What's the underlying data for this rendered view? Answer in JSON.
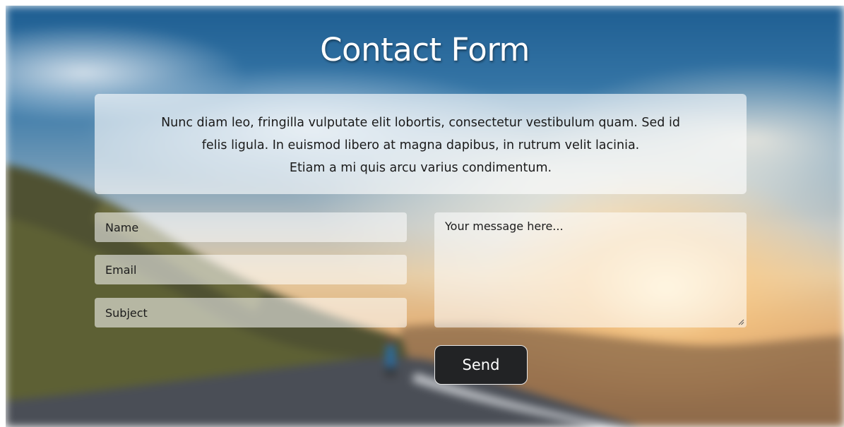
{
  "page": {
    "title": "Contact Form",
    "intro_lines": [
      "Nunc diam leo, fringilla vulputate elit lobortis, consectetur vestibulum quam. Sed id",
      "felis ligula. In euismod libero at magna dapibus, in rutrum velit lacinia.",
      "Etiam a mi quis arcu varius condimentum."
    ]
  },
  "form": {
    "name_placeholder": "Name",
    "email_placeholder": "Email",
    "subject_placeholder": "Subject",
    "message_placeholder": "Your message here...",
    "send_label": "Send"
  },
  "icons": {
    "resize": "resize-grip-icon"
  },
  "colors": {
    "button_bg": "#222325",
    "button_border": "#e8e8e8",
    "title_text": "#ffffff"
  }
}
